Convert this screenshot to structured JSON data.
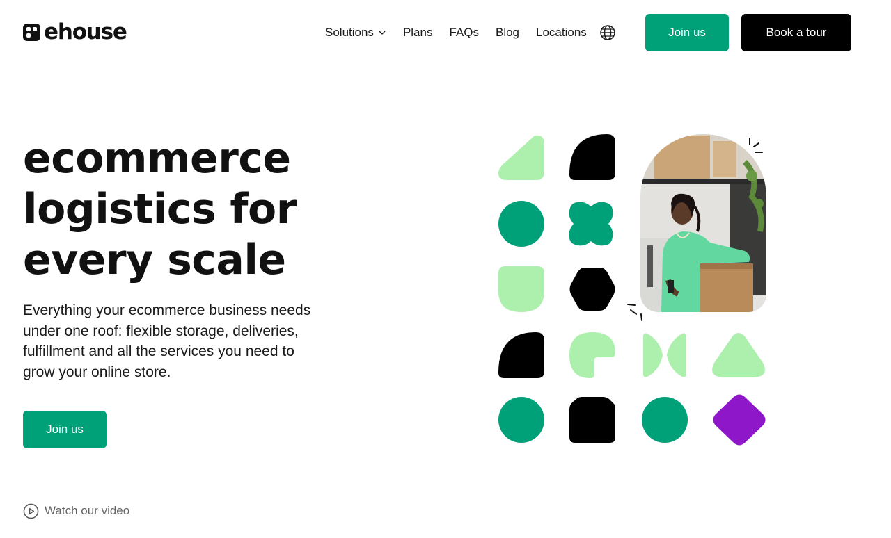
{
  "brand": {
    "name": "ehouse"
  },
  "nav": {
    "items": [
      {
        "label": "Solutions",
        "has_dropdown": true
      },
      {
        "label": "Plans"
      },
      {
        "label": "FAQs"
      },
      {
        "label": "Blog"
      },
      {
        "label": "Locations"
      }
    ],
    "language_icon": "globe-icon"
  },
  "header_buttons": {
    "join": "Join us",
    "tour": "Book a tour"
  },
  "hero": {
    "headline": [
      "ecommerce",
      "logistics for",
      "every scale"
    ],
    "subtext": "Everything your ecommerce business needs under one roof: flexible storage, deliveries, fulfillment and all the services you need to grow your online store.",
    "cta": "Join us",
    "video_link": "Watch our video"
  },
  "colors": {
    "accent_green": "#00a078",
    "light_green": "#adf0ad",
    "black": "#000000",
    "purple": "#8e17c9"
  },
  "decor": {
    "shapes": [
      "light-green-triangle",
      "black-quarter-circle",
      "green-circle",
      "green-cross-blob",
      "light-green-shield",
      "black-hexagon",
      "black-quarter-circle",
      "light-green-cutout-circle",
      "light-green-bowtie",
      "light-green-rounded-triangle",
      "green-circle",
      "black-house",
      "green-circle",
      "purple-diamond"
    ],
    "photo": "woman-packing-box-photo"
  }
}
